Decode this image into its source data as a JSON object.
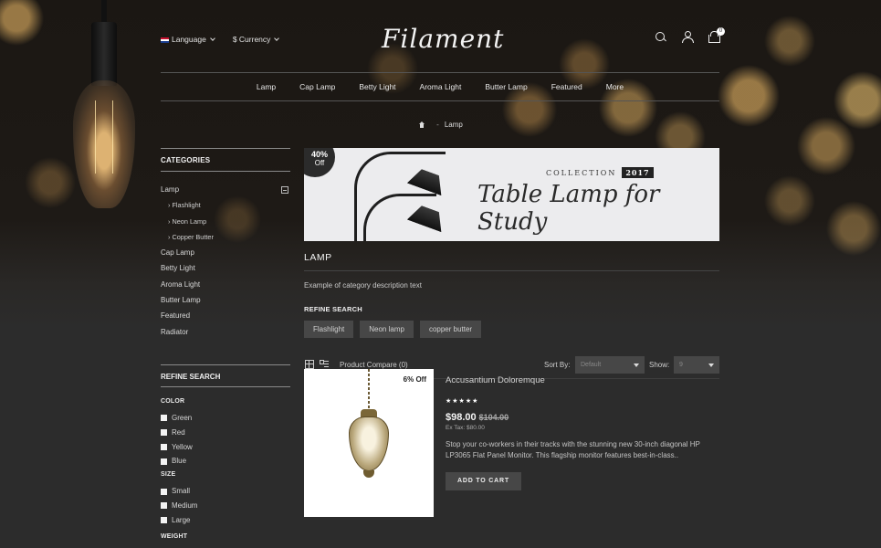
{
  "header": {
    "language": "Language",
    "currency": "$ Currency",
    "logo": "Filament",
    "cart_count": "0"
  },
  "nav": [
    "Lamp",
    "Cap Lamp",
    "Betty Light",
    "Aroma Light",
    "Butter Lamp",
    "Featured",
    "More"
  ],
  "breadcrumb": {
    "current": "Lamp"
  },
  "sidebar": {
    "categories_title": "CATEGORIES",
    "categories": [
      "Lamp",
      "Flashlight",
      "Neon Lamp",
      "Copper Butter",
      "Cap Lamp",
      "Betty Light",
      "Aroma Light",
      "Butter Lamp",
      "Featured",
      "Radiator"
    ],
    "refine_title": "REFINE SEARCH",
    "color_heading": "COLOR",
    "colors": [
      "Green",
      "Red",
      "Yellow",
      "Blue"
    ],
    "size_heading": "SIZE",
    "sizes": [
      "Small",
      "Medium",
      "Large"
    ],
    "weight_heading": "WEIGHT"
  },
  "banner": {
    "badge_pct": "40%",
    "badge_off": "Off",
    "collection": "COLLECTION",
    "year": "2017",
    "headline": "Table Lamp for Study"
  },
  "main": {
    "heading": "LAMP",
    "description": "Example of category description text",
    "refine_heading": "REFINE SEARCH",
    "refine_tags": [
      "Flashlight",
      "Neon lamp",
      "copper butter"
    ],
    "compare": "Product Compare (0)",
    "sort_label": "Sort By:",
    "sort_value": "Default",
    "show_label": "Show:",
    "show_value": "9"
  },
  "product": {
    "discount": "6% Off",
    "name": "Accusantium Doloremque",
    "stars": "★★★★★",
    "price": "$98.00",
    "old_price": "$104.00",
    "ex_tax": "Ex Tax: $80.00",
    "description": "Stop your co-workers in their tracks with the stunning new 30-inch diagonal HP LP3065 Flat Panel Monitor. This flagship monitor features best-in-class..",
    "add_to_cart": "ADD TO CART"
  }
}
